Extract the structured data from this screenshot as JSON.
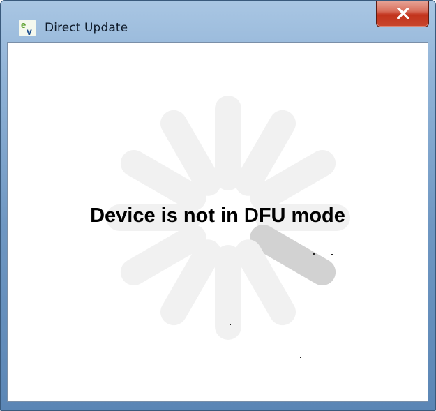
{
  "window": {
    "title": "Direct Update",
    "icon": "ev-app-icon",
    "close_icon": "close-x-icon"
  },
  "content": {
    "message": "Device is not in DFU mode",
    "spinner_icon": "loading-spinner-icon",
    "spinner_spoke_count": 12,
    "spinner_active_spoke": "lower-right"
  },
  "colors": {
    "close_button": "#c8462c",
    "spinner_spoke_light": "#f1f1f1",
    "spinner_spoke_active": "#d2d2d2",
    "message_text": "#000000"
  }
}
